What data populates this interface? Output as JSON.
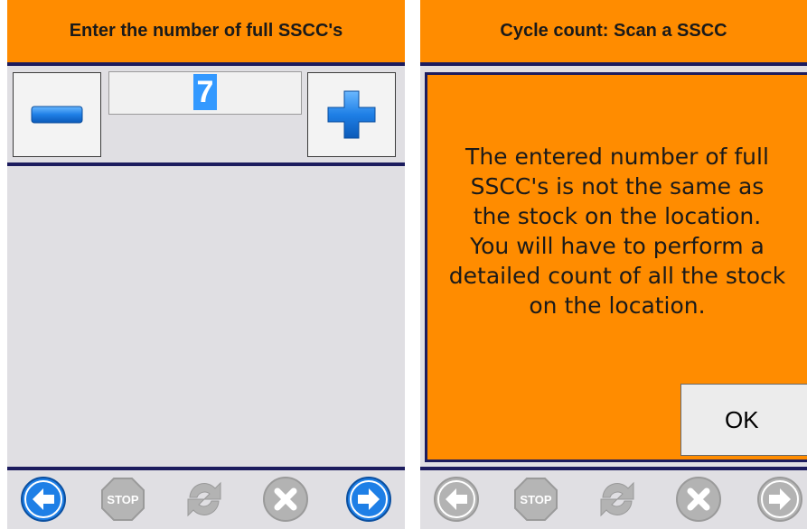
{
  "left_screen": {
    "title": "Enter the number of full SSCC's",
    "value": "7",
    "minus_icon": "minus-icon",
    "plus_icon": "plus-icon",
    "toolbar_icons": [
      "back-arrow-icon",
      "stop-icon",
      "refresh-icon",
      "cancel-icon",
      "forward-arrow-icon"
    ]
  },
  "right_screen": {
    "title": "Cycle count: Scan a SSCC",
    "message": "The entered number of full\nSSCC's is not the same as\nthe stock on the location.\nYou will have to perform a\ndetailed count of all the stock\non the location.",
    "ok_label": "OK",
    "toolbar_icons": [
      "back-arrow-icon",
      "stop-icon",
      "refresh-icon",
      "cancel-icon",
      "forward-arrow-icon"
    ]
  },
  "colors": {
    "header": "#ff8c00",
    "panel": "#e0dfe3",
    "rule": "#1c1c5e",
    "accent_blue": "#1e7fe6",
    "disabled_gray": "#a6a6a6"
  },
  "stop_label": "STOP"
}
